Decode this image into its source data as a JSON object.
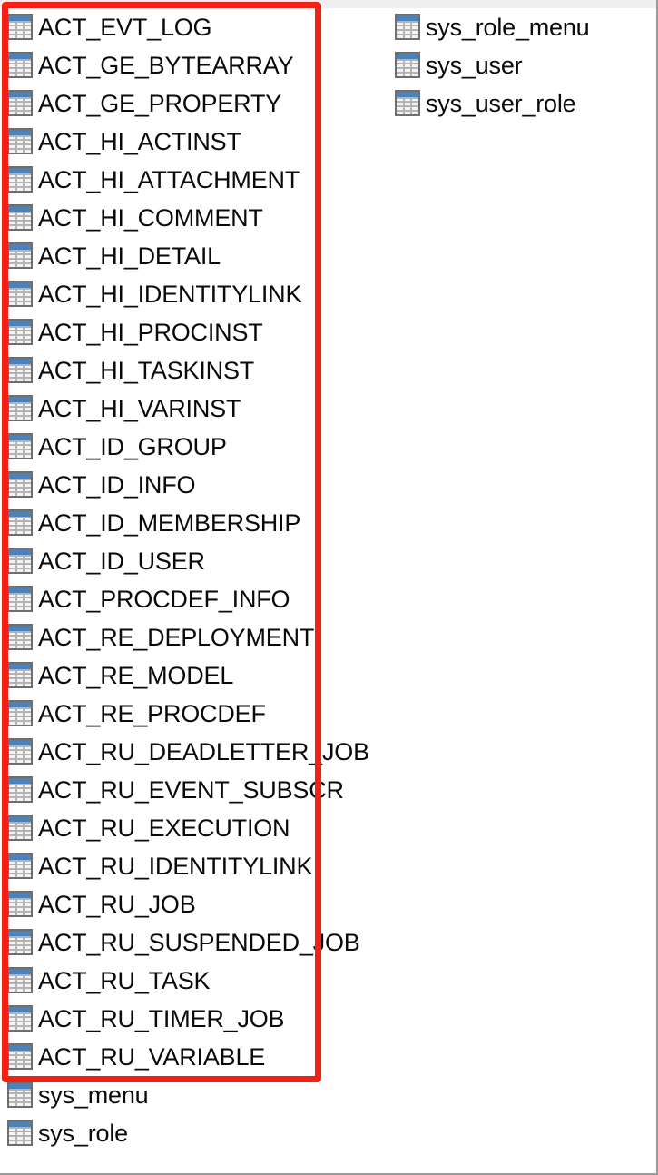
{
  "window": {
    "background_color": "#ffffff",
    "top_band_color": "#efefef",
    "frame_border_color": "#9a9a9a"
  },
  "annotation": {
    "type": "rectangle",
    "name": "activiti-tables-highlight",
    "color": "#f32013",
    "border_width_px": 7
  },
  "icon": {
    "semantic_name": "database-table-icon",
    "header_color": "#4a82be",
    "cell_fill": "#f4f4f4",
    "grid_line_color": "#b4b4b4",
    "outline_color": "#6e6e6e"
  },
  "table_list": {
    "left_column": [
      {
        "name": "ACT_EVT_LOG"
      },
      {
        "name": "ACT_GE_BYTEARRAY"
      },
      {
        "name": "ACT_GE_PROPERTY"
      },
      {
        "name": "ACT_HI_ACTINST"
      },
      {
        "name": "ACT_HI_ATTACHMENT"
      },
      {
        "name": "ACT_HI_COMMENT"
      },
      {
        "name": "ACT_HI_DETAIL"
      },
      {
        "name": "ACT_HI_IDENTITYLINK"
      },
      {
        "name": "ACT_HI_PROCINST"
      },
      {
        "name": "ACT_HI_TASKINST"
      },
      {
        "name": "ACT_HI_VARINST"
      },
      {
        "name": "ACT_ID_GROUP"
      },
      {
        "name": "ACT_ID_INFO"
      },
      {
        "name": "ACT_ID_MEMBERSHIP"
      },
      {
        "name": "ACT_ID_USER"
      },
      {
        "name": "ACT_PROCDEF_INFO"
      },
      {
        "name": "ACT_RE_DEPLOYMENT"
      },
      {
        "name": "ACT_RE_MODEL"
      },
      {
        "name": "ACT_RE_PROCDEF"
      },
      {
        "name": "ACT_RU_DEADLETTER_JOB"
      },
      {
        "name": "ACT_RU_EVENT_SUBSCR"
      },
      {
        "name": "ACT_RU_EXECUTION"
      },
      {
        "name": "ACT_RU_IDENTITYLINK"
      },
      {
        "name": "ACT_RU_JOB"
      },
      {
        "name": "ACT_RU_SUSPENDED_JOB"
      },
      {
        "name": "ACT_RU_TASK"
      },
      {
        "name": "ACT_RU_TIMER_JOB"
      },
      {
        "name": "ACT_RU_VARIABLE"
      },
      {
        "name": "sys_menu"
      },
      {
        "name": "sys_role"
      }
    ],
    "right_column": [
      {
        "name": "sys_role_menu"
      },
      {
        "name": "sys_user"
      },
      {
        "name": "sys_user_role"
      }
    ]
  }
}
